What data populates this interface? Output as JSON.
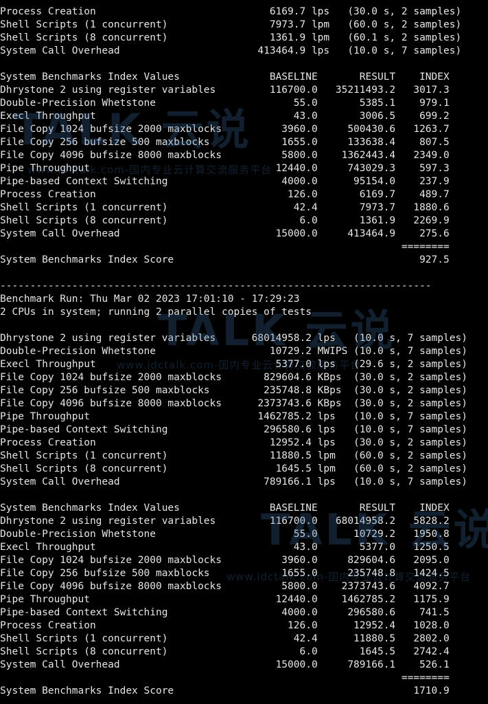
{
  "watermark": {
    "logo": "TALK 云说",
    "url": "www.idctalk.com-国内专业云计算交流服务平台"
  },
  "terminal": {
    "lines": [
      "Process Creation                             6169.7 lps   (30.0 s, 2 samples)",
      "Shell Scripts (1 concurrent)                 7973.7 lpm   (60.0 s, 2 samples)",
      "Shell Scripts (8 concurrent)                 1361.9 lpm   (60.1 s, 2 samples)",
      "System Call Overhead                       413464.9 lps   (10.0 s, 7 samples)",
      "",
      "System Benchmarks Index Values               BASELINE       RESULT    INDEX",
      "Dhrystone 2 using register variables         116700.0   35211493.2   3017.3",
      "Double-Precision Whetstone                       55.0       5385.1    979.1",
      "Execl Throughput                                 43.0       3006.5    699.2",
      "File Copy 1024 bufsize 2000 maxblocks          3960.0     500430.6   1263.7",
      "File Copy 256 bufsize 500 maxblocks            1655.0     133638.4    807.5",
      "File Copy 4096 bufsize 8000 maxblocks          5800.0    1362443.4   2349.0",
      "Pipe Throughput                               12440.0     743029.3    597.3",
      "Pipe-based Context Switching                   4000.0      95154.0    237.9",
      "Process Creation                                126.0       6169.7    489.7",
      "Shell Scripts (1 concurrent)                     42.4       7973.7   1880.6",
      "Shell Scripts (8 concurrent)                      6.0       1361.9   2269.9",
      "System Call Overhead                          15000.0     413464.9    275.6",
      "                                                                   ========",
      "System Benchmarks Index Score                                         927.5",
      "",
      "------------------------------------------------------------------------",
      "Benchmark Run: Thu Mar 02 2023 17:01:10 - 17:29:23",
      "2 CPUs in system; running 2 parallel copies of tests",
      "",
      "Dhrystone 2 using register variables      68014958.2 lps   (10.0 s, 7 samples)",
      "Double-Precision Whetstone                   10729.2 MWIPS (10.0 s, 7 samples)",
      "Execl Throughput                              5377.0 lps   (29.6 s, 2 samples)",
      "File Copy 1024 bufsize 2000 maxblocks       829604.6 KBps  (30.0 s, 2 samples)",
      "File Copy 256 bufsize 500 maxblocks         235748.8 KBps  (30.0 s, 2 samples)",
      "File Copy 4096 bufsize 8000 maxblocks      2373743.6 KBps  (30.0 s, 2 samples)",
      "Pipe Throughput                            1462785.2 lps   (10.0 s, 7 samples)",
      "Pipe-based Context Switching                296580.6 lps   (10.0 s, 7 samples)",
      "Process Creation                             12952.4 lps   (30.0 s, 2 samples)",
      "Shell Scripts (1 concurrent)                 11880.5 lpm   (60.0 s, 2 samples)",
      "Shell Scripts (8 concurrent)                  1645.5 lpm   (60.0 s, 2 samples)",
      "System Call Overhead                        789166.1 lps   (10.0 s, 7 samples)",
      "",
      "System Benchmarks Index Values               BASELINE       RESULT    INDEX",
      "Dhrystone 2 using register variables         116700.0   68014958.2   5828.2",
      "Double-Precision Whetstone                       55.0      10729.2   1950.8",
      "Execl Throughput                                 43.0       5377.0   1250.5",
      "File Copy 1024 bufsize 2000 maxblocks          3960.0     829604.6   2095.0",
      "File Copy 256 bufsize 500 maxblocks            1655.0     235748.8   1424.5",
      "File Copy 4096 bufsize 8000 maxblocks          5800.0    2373743.6   4092.7",
      "Pipe Throughput                               12440.0    1462785.2   1175.9",
      "Pipe-based Context Switching                   4000.0     296580.6    741.5",
      "Process Creation                                126.0      12952.4   1028.0",
      "Shell Scripts (1 concurrent)                     42.4      11880.5   2802.0",
      "Shell Scripts (8 concurrent)                      6.0       1645.5   2742.4",
      "System Call Overhead                          15000.0     789166.1    526.1",
      "                                                                   ========",
      "System Benchmarks Index Score                                        1710.9"
    ]
  }
}
